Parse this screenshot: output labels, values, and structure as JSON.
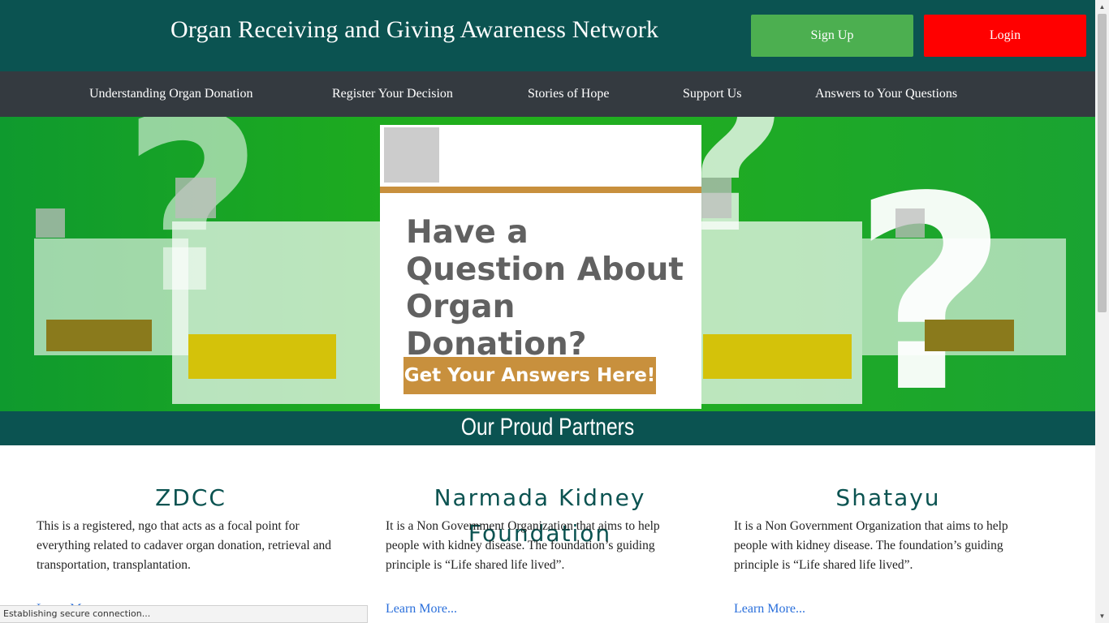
{
  "header": {
    "title": "Organ Receiving and Giving Awareness Network",
    "signup_label": "Sign Up",
    "login_label": "Login",
    "colors": {
      "bg": "#0b5351",
      "signup": "#4caf50",
      "login": "#ff0000"
    }
  },
  "nav": {
    "items": [
      {
        "label": "Understanding Organ Donation"
      },
      {
        "label": "Register Your Decision"
      },
      {
        "label": "Stories of Hope"
      },
      {
        "label": "Support Us"
      },
      {
        "label": "Answers to Your Questions"
      }
    ]
  },
  "hero": {
    "heading": "Have a Question About Organ Donation?",
    "cta_label": "Get Your Answers Here!",
    "decor_glyph": "?"
  },
  "partners": {
    "title": "Our Proud Partners",
    "items": [
      {
        "name": "ZDCC",
        "description": "This is a registered, ngo that acts as a focal point for everything related to cadaver organ donation, retrieval and transportation, transplantation.",
        "link_label": "Learn More..."
      },
      {
        "name": "Narmada Kidney Foundation",
        "description": "It is a Non Government Organization that aims to help people with kidney disease. The foundation’s guiding principle is “Life shared life lived”.",
        "link_label": "Learn More..."
      },
      {
        "name": "Shatayu",
        "description": "It is a Non Government Organization that aims to help people with kidney disease. The foundation’s guiding principle is “Life shared life lived”.",
        "link_label": "Learn More..."
      }
    ]
  },
  "status": {
    "text": "Establishing secure connection..."
  }
}
